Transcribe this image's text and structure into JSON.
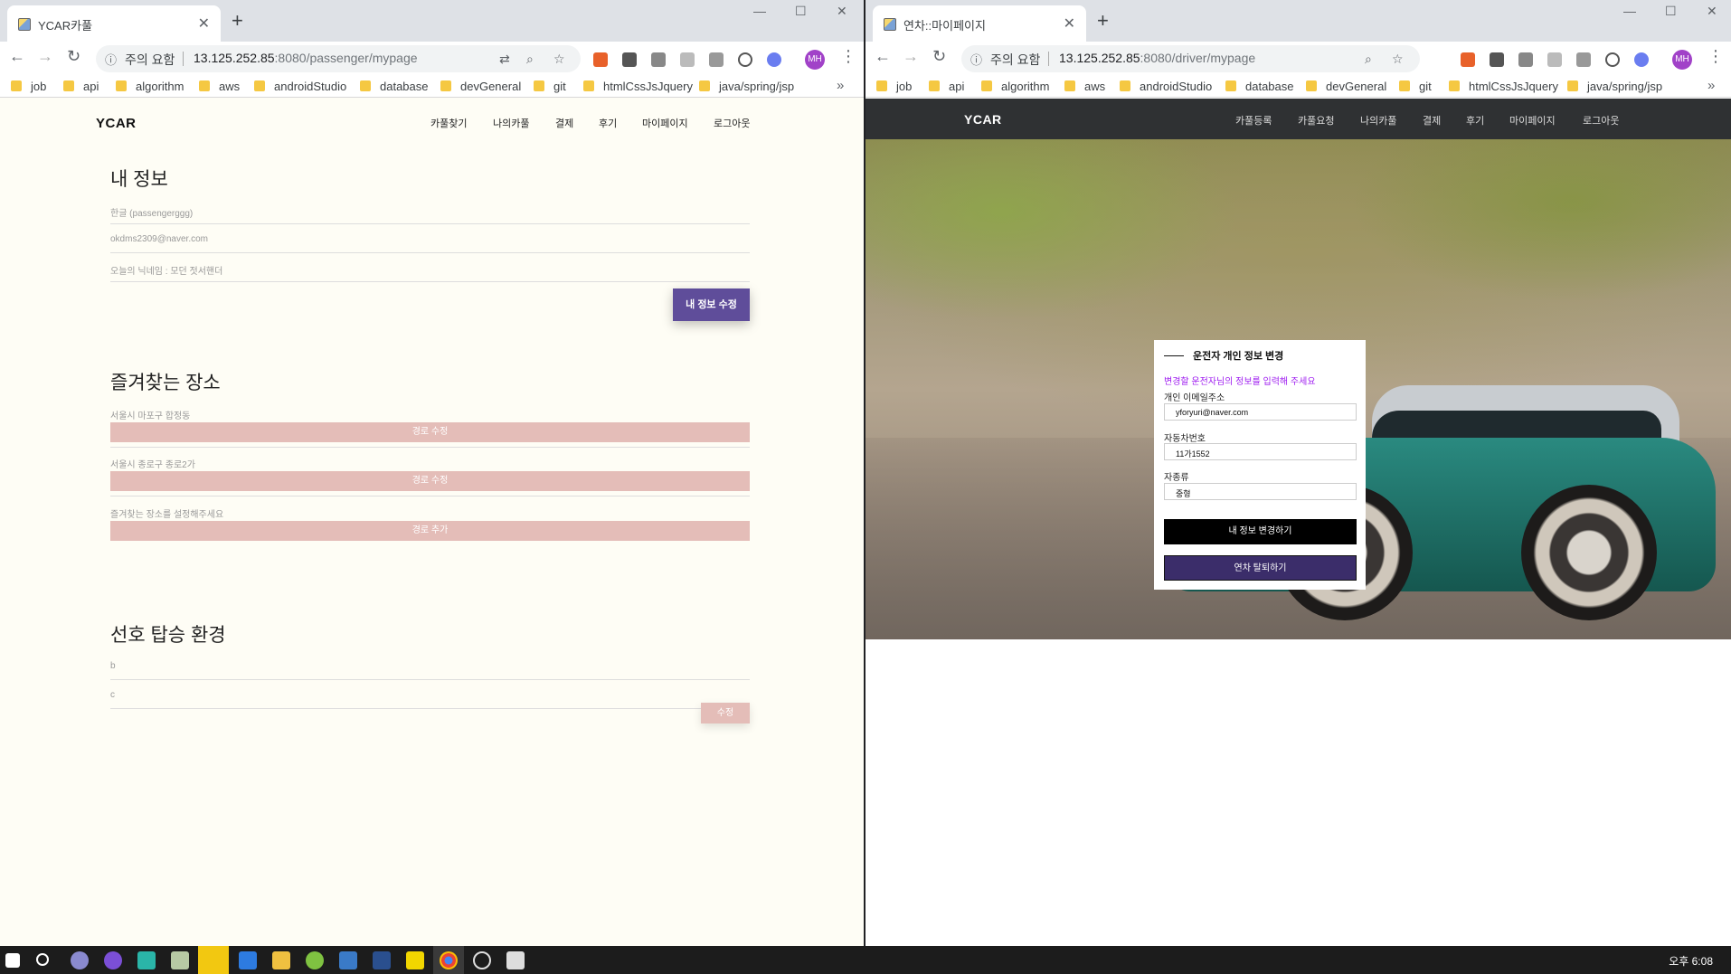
{
  "left_browser": {
    "tab_title": "YCAR카풀",
    "url_warning": "주의 요함",
    "url_host": "13.125.252.85",
    "url_path": ":8080/passenger/mypage",
    "bookmarks": [
      "job",
      "api",
      "algorithm",
      "aws",
      "androidStudio",
      "database",
      "devGeneral",
      "git",
      "htmlCssJsJquery",
      "java/spring/jsp"
    ],
    "avatar": "MH"
  },
  "left_page": {
    "logo": "YCAR",
    "nav": [
      "카풀찾기",
      "나의카풀",
      "결제",
      "후기",
      "마이페이지",
      "로그아웃"
    ],
    "my_info": {
      "heading": "내 정보",
      "name": "한글 (passengerggg)",
      "email": "okdms2309@naver.com",
      "nickname": "오늘의 닉네임 : 모던 젓서핸더",
      "edit_button": "내 정보 수정"
    },
    "favorites": {
      "heading": "즐겨찾는 장소",
      "items": [
        {
          "place": "서울시 마포구 합정동",
          "button": "경로 수정"
        },
        {
          "place": "서울시 종로구 종로2가",
          "button": "경로 수정"
        },
        {
          "place": "즐겨찾는 장소를 설정해주세요",
          "button": "경로 추가"
        }
      ]
    },
    "preferences": {
      "heading": "선호 탑승 환경",
      "values": [
        "b",
        "c"
      ],
      "button": "수정"
    }
  },
  "right_browser": {
    "tab_title": "연차::마이페이지",
    "url_warning": "주의 요함",
    "url_host": "13.125.252.85",
    "url_path": ":8080/driver/mypage",
    "bookmarks": [
      "job",
      "api",
      "algorithm",
      "aws",
      "androidStudio",
      "database",
      "devGeneral",
      "git",
      "htmlCssJsJquery",
      "java/spring/jsp"
    ],
    "avatar": "MH"
  },
  "right_page": {
    "logo": "YCAR",
    "nav": [
      "카풀등록",
      "카풀요청",
      "나의카풀",
      "결제",
      "후기",
      "마이페이지",
      "로그아웃"
    ],
    "form": {
      "title": "운전자 개인 정보 변경",
      "subtitle": "변경할 운전자님의 정보를 입력해 주세요",
      "email_label": "개인 이메일주소",
      "email_value": "yforyuri@naver.com",
      "plate_label": "자동차번호",
      "plate_value": "11가1552",
      "type_label": "자종류",
      "type_value": "중형",
      "update_button": "내 정보 변경하기",
      "withdraw_button": "연차 탈퇴하기"
    }
  },
  "taskbar": {
    "clock": "오후 6:08"
  }
}
